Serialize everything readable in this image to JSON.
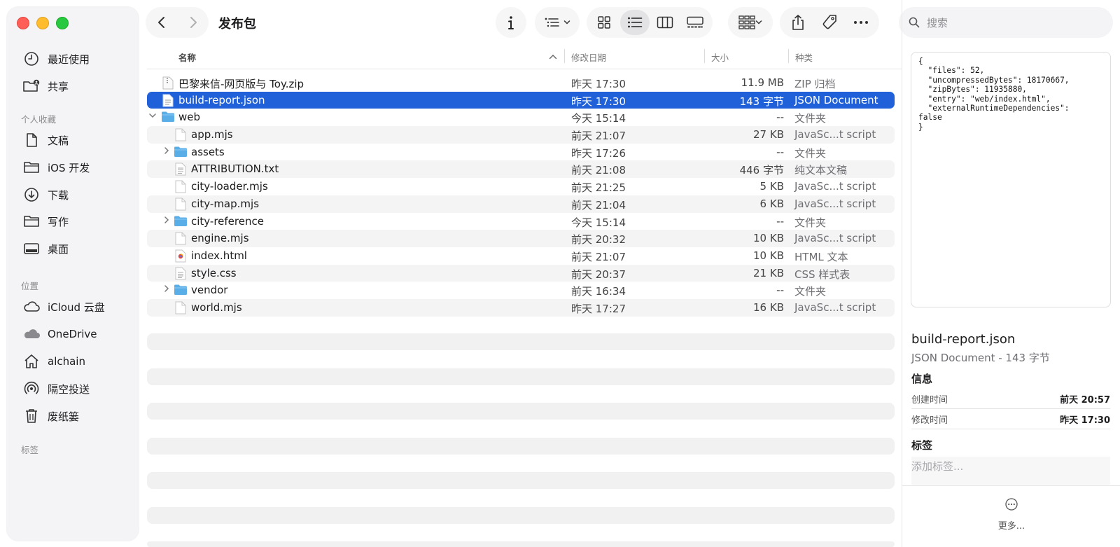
{
  "window": {
    "title": "发布包"
  },
  "sidebar": {
    "top_items": [
      {
        "label": "最近使用",
        "icon": "clock-icon"
      },
      {
        "label": "共享",
        "icon": "shared-folder-icon"
      }
    ],
    "favorites_header": "个人收藏",
    "favorites": [
      {
        "label": "文稿",
        "icon": "document-icon"
      },
      {
        "label": "iOS 开发",
        "icon": "folder-icon"
      },
      {
        "label": "下载",
        "icon": "download-icon"
      },
      {
        "label": "写作",
        "icon": "folder-icon"
      },
      {
        "label": "桌面",
        "icon": "desktop-icon"
      }
    ],
    "locations_header": "位置",
    "locations": [
      {
        "label": "iCloud 云盘",
        "icon": "cloud-icon"
      },
      {
        "label": "OneDrive",
        "icon": "onedrive-icon"
      },
      {
        "label": "alchain",
        "icon": "home-icon"
      },
      {
        "label": "隔空投送",
        "icon": "airdrop-icon"
      },
      {
        "label": "废纸篓",
        "icon": "trash-icon"
      }
    ],
    "tags_header": "标签"
  },
  "toolbar": {
    "search_placeholder": "搜索"
  },
  "columns": {
    "name": "名称",
    "date": "修改日期",
    "size": "大小",
    "kind": "种类"
  },
  "files": [
    {
      "name": "巴黎来信-网页版与 Toy.zip",
      "date": "昨天 17:30",
      "size": "11.9 MB",
      "kind": "ZIP 归档",
      "type": "zip",
      "indent": 0,
      "disclosure": "none"
    },
    {
      "name": "build-report.json",
      "date": "昨天 17:30",
      "size": "143 字节",
      "kind": "JSON Document",
      "type": "json",
      "indent": 0,
      "disclosure": "none",
      "selected": true
    },
    {
      "name": "web",
      "date": "今天 15:14",
      "size": "--",
      "kind": "文件夹",
      "type": "folder",
      "indent": 0,
      "disclosure": "open"
    },
    {
      "name": "app.mjs",
      "date": "前天 21:07",
      "size": "27 KB",
      "kind": "JavaSc...t script",
      "type": "file",
      "indent": 1,
      "disclosure": "none"
    },
    {
      "name": "assets",
      "date": "昨天 17:26",
      "size": "--",
      "kind": "文件夹",
      "type": "folder",
      "indent": 1,
      "disclosure": "closed"
    },
    {
      "name": "ATTRIBUTION.txt",
      "date": "前天 21:08",
      "size": "446 字节",
      "kind": "纯文本文稿",
      "type": "text",
      "indent": 1,
      "disclosure": "none"
    },
    {
      "name": "city-loader.mjs",
      "date": "前天 21:25",
      "size": "5 KB",
      "kind": "JavaSc...t script",
      "type": "file",
      "indent": 1,
      "disclosure": "none"
    },
    {
      "name": "city-map.mjs",
      "date": "前天 21:04",
      "size": "6 KB",
      "kind": "JavaSc...t script",
      "type": "file",
      "indent": 1,
      "disclosure": "none"
    },
    {
      "name": "city-reference",
      "date": "今天 15:14",
      "size": "--",
      "kind": "文件夹",
      "type": "folder",
      "indent": 1,
      "disclosure": "closed"
    },
    {
      "name": "engine.mjs",
      "date": "前天 20:32",
      "size": "10 KB",
      "kind": "JavaSc...t script",
      "type": "file",
      "indent": 1,
      "disclosure": "none"
    },
    {
      "name": "index.html",
      "date": "前天 21:07",
      "size": "10 KB",
      "kind": "HTML 文本",
      "type": "html",
      "indent": 1,
      "disclosure": "none"
    },
    {
      "name": "style.css",
      "date": "前天 20:37",
      "size": "21 KB",
      "kind": "CSS 样式表",
      "type": "text",
      "indent": 1,
      "disclosure": "none"
    },
    {
      "name": "vendor",
      "date": "前天 16:34",
      "size": "--",
      "kind": "文件夹",
      "type": "folder",
      "indent": 1,
      "disclosure": "closed"
    },
    {
      "name": "world.mjs",
      "date": "昨天 17:27",
      "size": "16 KB",
      "kind": "JavaSc...t script",
      "type": "file",
      "indent": 1,
      "disclosure": "none"
    }
  ],
  "inspector": {
    "preview_text": "{\n  \"files\": 52,\n  \"uncompressedBytes\": 18170667,\n  \"zipBytes\": 11935880,\n  \"entry\": \"web/index.html\",\n  \"externalRuntimeDependencies\":\nfalse\n}",
    "file_name": "build-report.json",
    "file_sub": "JSON Document - 143 字节",
    "info_header": "信息",
    "created_label": "创建时间",
    "created_value": "前天 20:57",
    "modified_label": "修改时间",
    "modified_value": "昨天 17:30",
    "tags_header": "标签",
    "tags_placeholder": "添加标签...",
    "more_label": "更多..."
  },
  "colors": {
    "selection": "#2060d8",
    "folder": "#5aaee8",
    "close": "#ff5f57",
    "minimize": "#febc2e",
    "maximize": "#28c840"
  }
}
